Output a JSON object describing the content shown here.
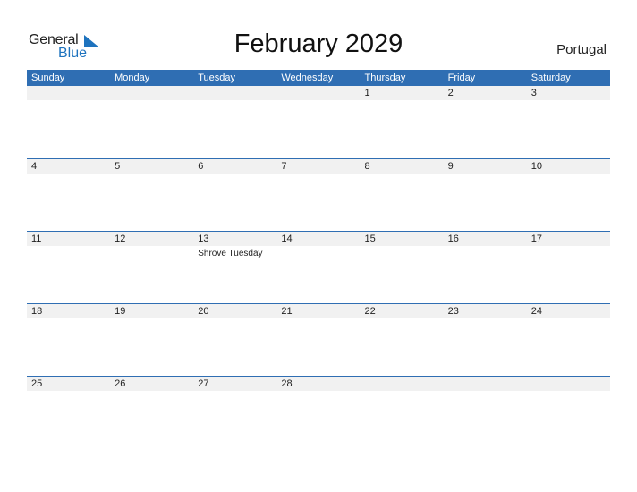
{
  "logo": {
    "word1": "General",
    "word2": "Blue"
  },
  "title": "February 2029",
  "country": "Portugal",
  "weekdays": [
    "Sunday",
    "Monday",
    "Tuesday",
    "Wednesday",
    "Thursday",
    "Friday",
    "Saturday"
  ],
  "weeks": [
    [
      {
        "d": ""
      },
      {
        "d": ""
      },
      {
        "d": ""
      },
      {
        "d": ""
      },
      {
        "d": "1"
      },
      {
        "d": "2"
      },
      {
        "d": "3"
      }
    ],
    [
      {
        "d": "4"
      },
      {
        "d": "5"
      },
      {
        "d": "6"
      },
      {
        "d": "7"
      },
      {
        "d": "8"
      },
      {
        "d": "9"
      },
      {
        "d": "10"
      }
    ],
    [
      {
        "d": "11"
      },
      {
        "d": "12"
      },
      {
        "d": "13",
        "event": "Shrove Tuesday"
      },
      {
        "d": "14"
      },
      {
        "d": "15"
      },
      {
        "d": "16"
      },
      {
        "d": "17"
      }
    ],
    [
      {
        "d": "18"
      },
      {
        "d": "19"
      },
      {
        "d": "20"
      },
      {
        "d": "21"
      },
      {
        "d": "22"
      },
      {
        "d": "23"
      },
      {
        "d": "24"
      }
    ],
    [
      {
        "d": "25"
      },
      {
        "d": "26"
      },
      {
        "d": "27"
      },
      {
        "d": "28"
      },
      {
        "d": ""
      },
      {
        "d": ""
      },
      {
        "d": ""
      }
    ]
  ],
  "colors": {
    "header": "#2f6eb3",
    "brand_blue": "#1e73be",
    "date_band": "#f1f1f1"
  }
}
